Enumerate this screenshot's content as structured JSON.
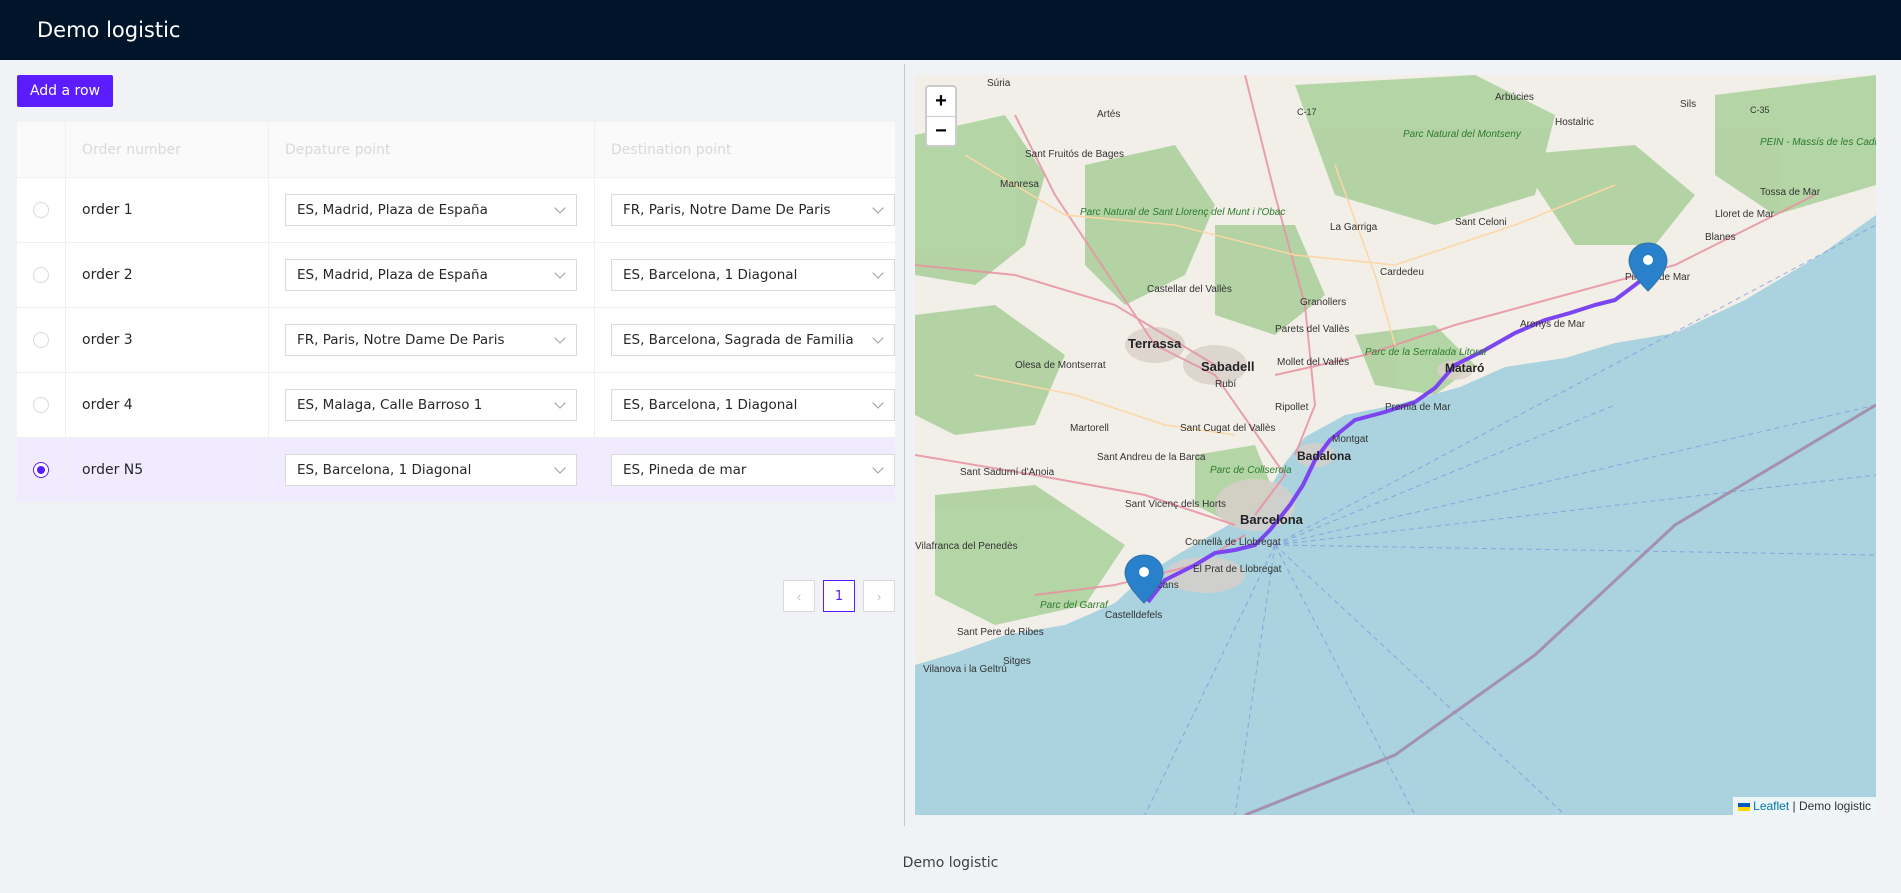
{
  "header": {
    "title": "Demo logistic"
  },
  "toolbar": {
    "add_row_label": "Add a row"
  },
  "table": {
    "columns": [
      "",
      "Order number",
      "Depature point",
      "Destination point"
    ],
    "rows": [
      {
        "order": "order 1",
        "departure": "ES, Madrid, Plaza de España",
        "destination": "FR, Paris, Notre Dame De Paris",
        "selected": false
      },
      {
        "order": "order 2",
        "departure": "ES, Madrid, Plaza de España",
        "destination": "ES, Barcelona, 1 Diagonal",
        "selected": false
      },
      {
        "order": "order 3",
        "departure": "FR, Paris, Notre Dame De Paris",
        "destination": "ES, Barcelona, Sagrada de Familia",
        "selected": false
      },
      {
        "order": "order 4",
        "departure": "ES, Malaga, Calle Barroso 1",
        "destination": "ES, Barcelona, 1 Diagonal",
        "selected": false
      },
      {
        "order": "order N5",
        "departure": "ES, Barcelona, 1 Diagonal",
        "destination": "ES, Pineda de mar",
        "selected": true
      }
    ]
  },
  "pagination": {
    "prev": "‹",
    "current_page": "1",
    "next": "›"
  },
  "map": {
    "zoom_in": "+",
    "zoom_out": "−",
    "attribution_link": "Leaflet",
    "attribution_separator": " | ",
    "attribution_text": "Demo logistic",
    "labels": [
      "Súria",
      "Artés",
      "Sant Fruitós de Bages",
      "Manresa",
      "Arbúcies",
      "Parc Natural del Montseny",
      "Hostalric",
      "Sils",
      "PEIN - Massís de les Cadiretes",
      "Tossa de Mar",
      "Lloret de Mar",
      "Blanes",
      "Parc Natural de Sant Llorenç del Munt i l'Obac",
      "La Garriga",
      "Sant Celoni",
      "Cardedeu",
      "Castellar del Vallès",
      "Granollers",
      "Terrassa",
      "Sabadell",
      "Parets del Vallès",
      "Mollet del Vallès",
      "Olesa de Montserrat",
      "Parc de la Serralada Litoral",
      "Mataró",
      "Arenys de Mar",
      "Pineda de Mar",
      "Rubí",
      "Ripollet",
      "Martorell",
      "Sant Cugat del Vallès",
      "Sant Andreu de la Barca",
      "Premià de Mar",
      "Montgat",
      "Badalona",
      "Sant Sadurní d'Anoia",
      "Parc de Collserola",
      "Sant Vicenç dels Horts",
      "Barcelona",
      "Cornellà de Llobregat",
      "Vilafranca del Penedès",
      "El Prat de Llobregat",
      "Viladecans",
      "Parc del Garraf",
      "Castelldefels",
      "Sant Pere de Ribes",
      "Vilanova i la Geltrú",
      "Sitges",
      "C-17",
      "C-35"
    ],
    "colors": {
      "sea": "#aad3df",
      "land": "#f2efe9",
      "forest": "#add19e",
      "route": "#7b45f0",
      "marker": "#2a81cb"
    }
  },
  "footer": {
    "text": "Demo logistic"
  }
}
